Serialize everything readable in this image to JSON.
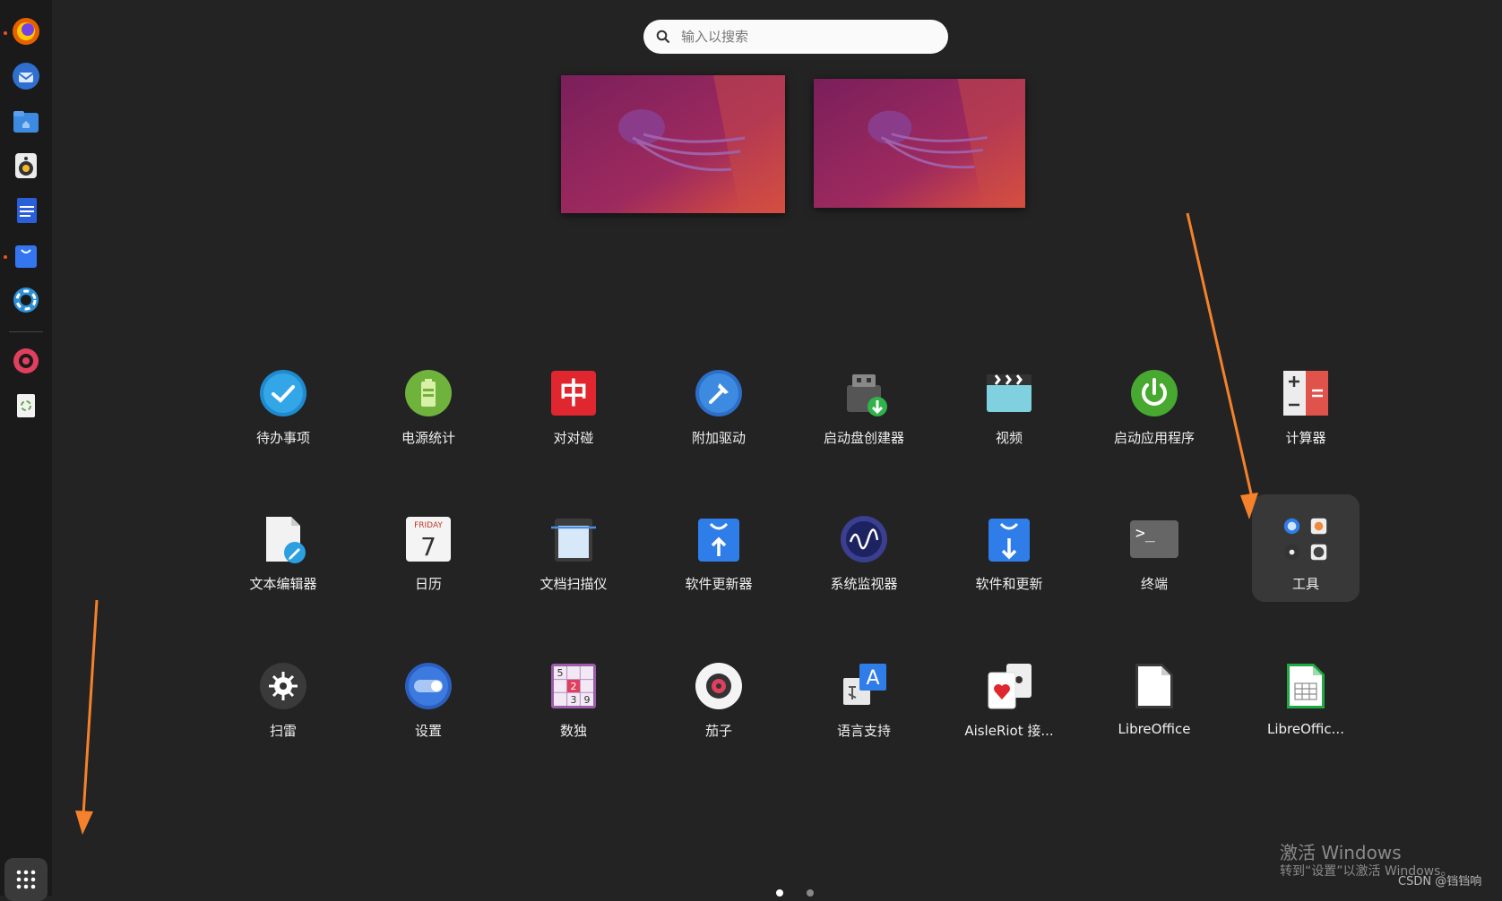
{
  "search": {
    "placeholder": "输入以搜索"
  },
  "apps": {
    "row1": [
      "待办事项",
      "电源统计",
      "对对碰",
      "附加驱动",
      "启动盘创建器",
      "视频",
      "启动应用程序",
      "计算器"
    ],
    "row2": [
      "文本编辑器",
      "日历",
      "文档扫描仪",
      "软件更新器",
      "系统监视器",
      "软件和更新",
      "终端",
      "工具"
    ],
    "row3": [
      "扫雷",
      "设置",
      "数独",
      "茄子",
      "语言支持",
      "AisleRiot 接...",
      "LibreOffice",
      "LibreOffic..."
    ]
  },
  "calendar": {
    "day_name": "FRIDAY",
    "day_num": "7"
  },
  "colorgame": {
    "glyph": "中"
  },
  "sudoku": {
    "digits": [
      "5",
      "2",
      "3",
      "9"
    ]
  },
  "lang": {
    "glyph": "A"
  },
  "terminal": {
    "prompt": ">_"
  },
  "watermark": {
    "line1": "激活 Windows",
    "line2": "转到“设置”以激活 Windows。"
  },
  "credit": "CSDN @铛铛响",
  "colors": {
    "accent": "#e95420",
    "arrow": "#f5822a",
    "bg": "#232323"
  }
}
